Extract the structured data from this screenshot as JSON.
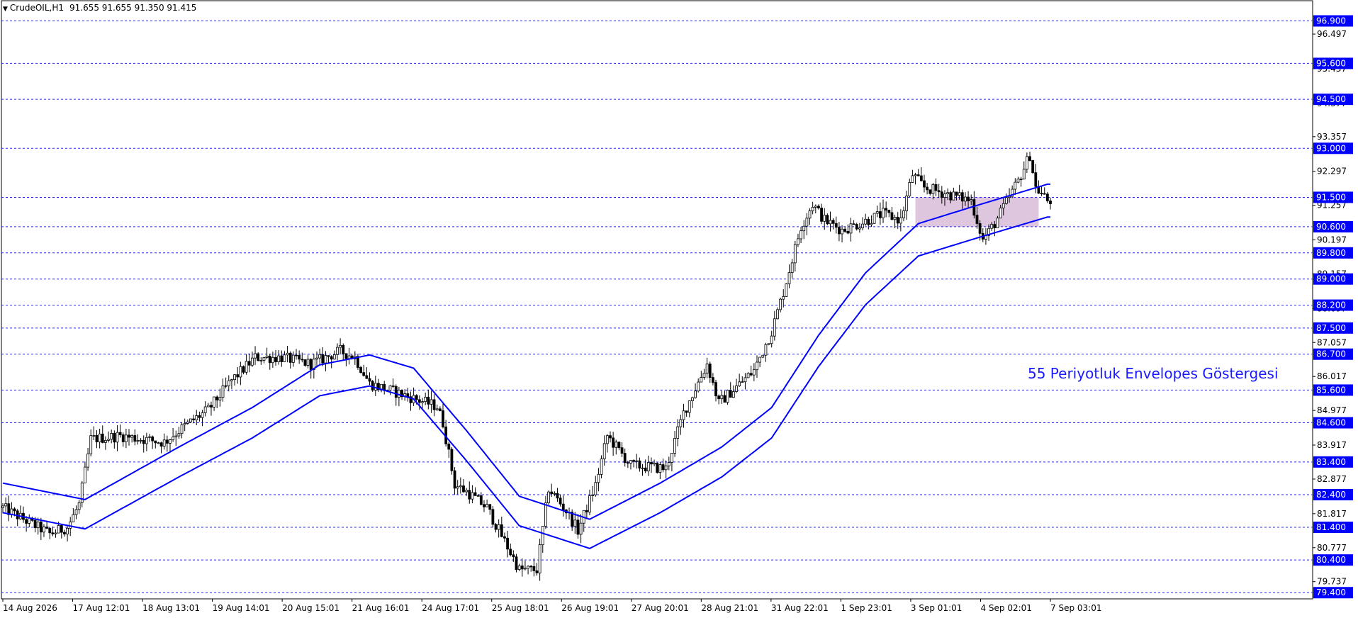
{
  "header": {
    "symbol": "CrudeOIL,H1",
    "ohlc": "91.655 91.655 91.350 91.415"
  },
  "annotation": "55 Periyotluk Envelopes Göstergesi",
  "colors": {
    "level_line": "#2b2bd6",
    "envelope": "#0000ff",
    "zone_fill": "#d8bcd8",
    "label_bg": "#0000ff",
    "label_text": "#ffffff",
    "candle": "#000000",
    "axis": "#000000"
  },
  "chart_data": {
    "type": "candlestick",
    "title": "",
    "ylim": [
      79.21,
      97.54
    ],
    "y_ticks": [
      "96.497",
      "95.437",
      "94.377",
      "93.357",
      "92.297",
      "91.257",
      "90.197",
      "89.157",
      "88.097",
      "87.057",
      "86.017",
      "84.977",
      "83.917",
      "82.877",
      "81.817",
      "80.777",
      "79.737"
    ],
    "x_labels": [
      "14 Aug 2026",
      "17 Aug 12:01",
      "18 Aug 13:01",
      "19 Aug 14:01",
      "20 Aug 15:01",
      "21 Aug 16:01",
      "24 Aug 17:01",
      "25 Aug 18:01",
      "26 Aug 19:01",
      "27 Aug 20:01",
      "28 Aug 21:01",
      "31 Aug 22:01",
      "1 Sep 23:01",
      "3 Sep 01:01",
      "4 Sep 02:01",
      "7 Sep 03:01"
    ],
    "levels": [
      "96.900",
      "95.600",
      "94.500",
      "93.000",
      "91.500",
      "90.600",
      "89.800",
      "89.000",
      "88.200",
      "87.500",
      "86.700",
      "85.600",
      "84.600",
      "83.400",
      "82.400",
      "81.400",
      "80.400",
      "79.400"
    ],
    "zone": {
      "y_from": 90.6,
      "y_to": 91.5,
      "x_from_bar": 311,
      "x_to_bar": 353
    },
    "close_path": [
      [
        0,
        82.0
      ],
      [
        8,
        81.6
      ],
      [
        16,
        81.2
      ],
      [
        22,
        81.4
      ],
      [
        26,
        82.1
      ],
      [
        30,
        84.1
      ],
      [
        40,
        84.2
      ],
      [
        55,
        84.0
      ],
      [
        62,
        84.5
      ],
      [
        70,
        85.0
      ],
      [
        78,
        85.9
      ],
      [
        86,
        86.6
      ],
      [
        95,
        86.6
      ],
      [
        105,
        86.4
      ],
      [
        115,
        86.8
      ],
      [
        120,
        86.6
      ],
      [
        125,
        85.8
      ],
      [
        135,
        85.5
      ],
      [
        148,
        85.1
      ],
      [
        150,
        84.6
      ],
      [
        154,
        82.7
      ],
      [
        158,
        82.5
      ],
      [
        165,
        82.0
      ],
      [
        172,
        80.8
      ],
      [
        176,
        80.1
      ],
      [
        182,
        80.1
      ],
      [
        186,
        82.6
      ],
      [
        192,
        81.9
      ],
      [
        196,
        81.3
      ],
      [
        202,
        82.7
      ],
      [
        206,
        84.2
      ],
      [
        214,
        83.3
      ],
      [
        226,
        83.2
      ],
      [
        232,
        84.9
      ],
      [
        240,
        86.4
      ],
      [
        244,
        85.2
      ],
      [
        256,
        86.2
      ],
      [
        262,
        87.4
      ],
      [
        266,
        88.6
      ],
      [
        272,
        90.6
      ],
      [
        276,
        91.3
      ],
      [
        280,
        90.8
      ],
      [
        286,
        90.5
      ],
      [
        292,
        90.7
      ],
      [
        300,
        91.0
      ],
      [
        306,
        90.8
      ],
      [
        310,
        92.2
      ],
      [
        314,
        91.8
      ],
      [
        322,
        91.6
      ],
      [
        330,
        91.4
      ],
      [
        334,
        90.2
      ],
      [
        338,
        90.7
      ],
      [
        346,
        92.0
      ],
      [
        350,
        92.8
      ],
      [
        352,
        91.8
      ],
      [
        356,
        91.4
      ]
    ],
    "envelope_center": [
      [
        0,
        82.3
      ],
      [
        28,
        81.8
      ],
      [
        60,
        83.4
      ],
      [
        85,
        84.6
      ],
      [
        108,
        85.9
      ],
      [
        125,
        86.2
      ],
      [
        140,
        85.8
      ],
      [
        158,
        83.9
      ],
      [
        176,
        81.9
      ],
      [
        200,
        81.2
      ],
      [
        224,
        82.3
      ],
      [
        245,
        83.4
      ],
      [
        262,
        84.6
      ],
      [
        278,
        86.8
      ],
      [
        294,
        88.7
      ],
      [
        312,
        90.2
      ],
      [
        330,
        90.7
      ],
      [
        356,
        91.4
      ]
    ],
    "envelope_pct": 0.55,
    "n_bars": 358,
    "annotations": [
      "55 Periyotluk Envelopes Göstergesi"
    ]
  }
}
